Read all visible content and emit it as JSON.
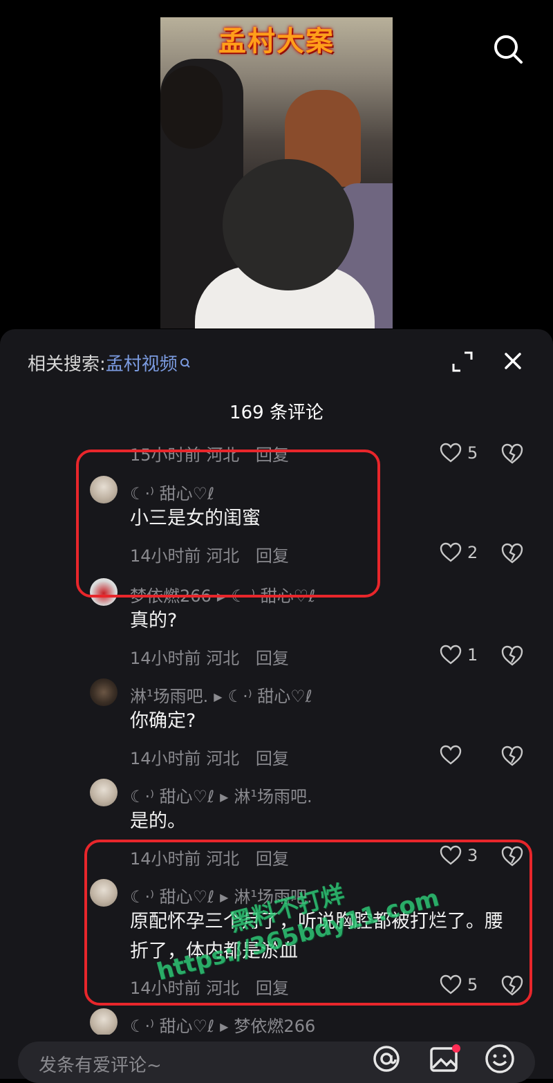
{
  "video": {
    "title": "孟村大案"
  },
  "header": {
    "related_label": "相关搜索:",
    "related_keyword": "孟村视频",
    "comment_count": "169 条评论"
  },
  "comments": [
    {
      "meta_time": "15小时前",
      "meta_region": "河北",
      "reply": "回复",
      "likes": "5"
    },
    {
      "name": "☾·⁾ 甜心♡ℓ",
      "text": "小三是女的闺蜜",
      "meta_time": "14小时前",
      "meta_region": "河北",
      "reply": "回复",
      "likes": "2"
    },
    {
      "name": "梦依燃266",
      "reply_to": "☾·⁾ 甜心♡ℓ",
      "text": "真的?",
      "meta_time": "14小时前",
      "meta_region": "河北",
      "reply": "回复",
      "likes": "1"
    },
    {
      "name": "淋¹场雨吧.",
      "reply_to": "☾·⁾ 甜心♡ℓ",
      "text": "你确定?",
      "meta_time": "14小时前",
      "meta_region": "河北",
      "reply": "回复",
      "likes": ""
    },
    {
      "name": "☾·⁾ 甜心♡ℓ",
      "reply_to": "淋¹场雨吧.",
      "text": "是的。",
      "meta_time": "14小时前",
      "meta_region": "河北",
      "reply": "回复",
      "likes": "3"
    },
    {
      "name": "☾·⁾ 甜心♡ℓ",
      "reply_to": "淋¹场雨吧.",
      "text": "原配怀孕三个月了，听说胸腔都被打烂了。腰折了，体内都是淤血",
      "meta_time": "14小时前",
      "meta_region": "河北",
      "reply": "回复",
      "likes": "5"
    },
    {
      "name": "☾·⁾ 甜心♡ℓ",
      "reply_to": "梦依燃266"
    }
  ],
  "watermark": {
    "line1": "黑料不打烊",
    "line2": "https://365bdy11.com"
  },
  "input": {
    "placeholder": "发条有爱评论~"
  },
  "colors": {
    "annotation": "#e8262b",
    "keyword": "#7b9be0",
    "sheet": "#17171b"
  }
}
